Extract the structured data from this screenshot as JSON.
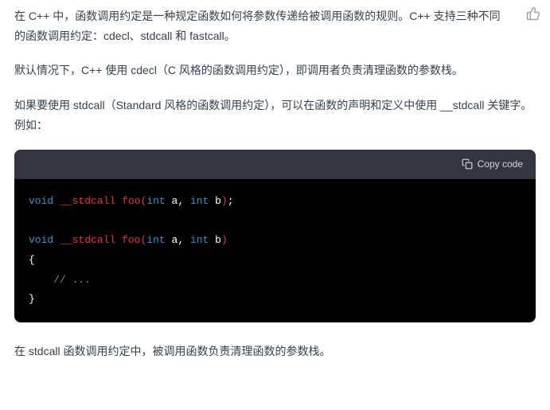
{
  "paragraphs": {
    "p1": "在 C++ 中，函数调用约定是一种规定函数如何将参数传递给被调用函数的规则。C++ 支持三种不同的函数调用约定：cdecl、stdcall 和 fastcall。",
    "p2": "默认情况下，C++ 使用 cdecl（C 风格的函数调用约定），即调用者负责清理函数的参数栈。",
    "p3": "如果要使用 stdcall（Standard 风格的函数调用约定），可以在函数的声明和定义中使用 __stdcall 关键字。例如：",
    "p4": "在 stdcall 函数调用约定中，被调用函数负责清理函数的参数栈。"
  },
  "code": {
    "copy_label": "Copy code",
    "tokens": {
      "void": "void",
      "stdcall": "__stdcall",
      "foo": "foo",
      "lparen": "(",
      "int": "int",
      "a": "a",
      "comma": ",",
      "b": "b",
      "rparen": ")",
      "semi": ";",
      "lbrace": "{",
      "comment": "// ...",
      "rbrace": "}"
    },
    "raw": "void __stdcall foo(int a, int b);\n\nvoid __stdcall foo(int a, int b)\n{\n    // ...\n}"
  }
}
